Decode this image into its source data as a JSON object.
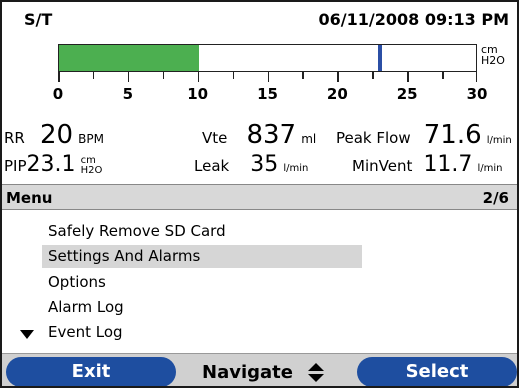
{
  "header": {
    "mode": "S/T",
    "datetime": "06/11/2008 09:13 PM"
  },
  "pressure_bar": {
    "unit_line1": "cm",
    "unit_line2": "H2O",
    "scale_min": 0,
    "scale_max": 30,
    "fill_value": 10,
    "marker_value": 23,
    "fill_color": "#4caf50",
    "marker_color": "#2b4fa5",
    "tick_labels": [
      "0",
      "5",
      "10",
      "15",
      "20",
      "25",
      "30"
    ]
  },
  "readings": {
    "rr": {
      "label": "RR",
      "value": "20",
      "unit": "BPM"
    },
    "vte": {
      "label": "Vte",
      "value": "837",
      "unit": "ml"
    },
    "peak_flow": {
      "label": "Peak Flow",
      "value": "71.6",
      "unit": "l/min"
    },
    "pip": {
      "label": "PIP",
      "value": "23.1",
      "unit_top": "cm",
      "unit_bottom": "H2O"
    },
    "leak": {
      "label": "Leak",
      "value": "35",
      "unit": "l/min"
    },
    "minvent": {
      "label": "MinVent",
      "value": "11.7",
      "unit": "l/min"
    }
  },
  "menu": {
    "title": "Menu",
    "page": "2/6",
    "items": [
      {
        "label": "Safely Remove SD Card"
      },
      {
        "label": "Settings And Alarms",
        "selected": true
      },
      {
        "label": "Options"
      },
      {
        "label": "Alarm Log"
      },
      {
        "label": "Event Log"
      }
    ]
  },
  "softkeys": {
    "left": "Exit",
    "center": "Navigate",
    "right": "Select",
    "accent": "#1e4ea0"
  }
}
